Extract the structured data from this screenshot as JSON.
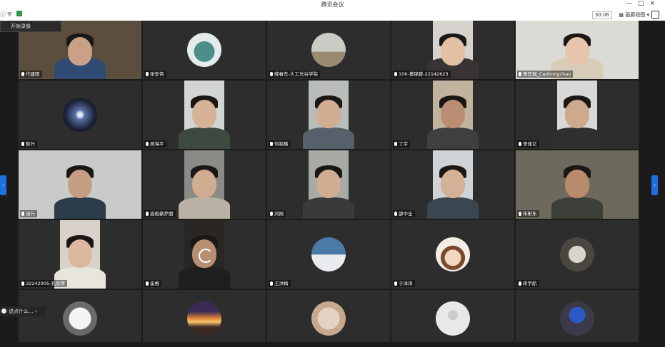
{
  "window": {
    "title": "腾讯会议",
    "controls": [
      "—",
      "□",
      "×"
    ]
  },
  "toolbar": {
    "timer": "30:06",
    "view_label": "画廊视图"
  },
  "popup": {
    "label": "开始录像"
  },
  "chat": {
    "placeholder": "说点什么..."
  },
  "colors": {
    "tile_bg": "#2d2d2d",
    "page_bg": "#1b1b1b",
    "accent": "#1f6fe0"
  },
  "participants": [
    {
      "name": "代建阳",
      "type": "video"
    },
    {
      "name": "张安伟",
      "type": "avatar",
      "avatar": "teal-hooded-figure"
    },
    {
      "name": "薛春东-大工光谷学院",
      "type": "avatar",
      "avatar": "people-photo"
    },
    {
      "name": "106-葛锦蓉-22142623",
      "type": "video"
    },
    {
      "name": "曹登瑞_Caohongchao",
      "type": "video"
    },
    {
      "name": "智行",
      "type": "avatar",
      "avatar": "galaxy"
    },
    {
      "name": "吴海平",
      "type": "video"
    },
    {
      "name": "何祖楠",
      "type": "video"
    },
    {
      "name": "丁宇",
      "type": "video"
    },
    {
      "name": "李佳它",
      "type": "video"
    },
    {
      "name": "张行",
      "type": "video"
    },
    {
      "name": "高俊豪乔丽",
      "type": "video"
    },
    {
      "name": "刘刚",
      "type": "video"
    },
    {
      "name": "邵中全",
      "type": "video"
    },
    {
      "name": "朱彬东",
      "type": "video"
    },
    {
      "name": "32242005-孔欣荷",
      "type": "video"
    },
    {
      "name": "崔格",
      "type": "video"
    },
    {
      "name": "王洪梅",
      "type": "avatar",
      "avatar": "snow-scene"
    },
    {
      "name": "于洋洋",
      "type": "avatar",
      "avatar": "cartoon-boy"
    },
    {
      "name": "蒋宇航",
      "type": "avatar",
      "avatar": "cat-photo"
    },
    {
      "name": "",
      "type": "avatar",
      "avatar": "white-dog"
    },
    {
      "name": "",
      "type": "avatar",
      "avatar": "sunset"
    },
    {
      "name": "",
      "type": "avatar",
      "avatar": "cat-cartoon"
    },
    {
      "name": "",
      "type": "avatar",
      "avatar": "default-user"
    },
    {
      "name": "",
      "type": "avatar",
      "avatar": "blue-character"
    }
  ]
}
